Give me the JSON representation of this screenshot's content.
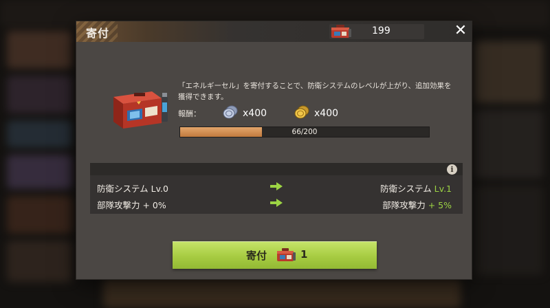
{
  "dialog": {
    "title": "寄付",
    "currency_value": "199",
    "close_label": "✕",
    "description": "「エネルギーセル」を寄付することで、防衛システムのレベルが上がり、追加効果を獲得できます。",
    "reward_label": "報酬：",
    "rewards": [
      {
        "icon": "silver-coin-icon",
        "amount": "x400"
      },
      {
        "icon": "gold-coin-icon",
        "amount": "x400"
      }
    ],
    "progress": {
      "text": "66/200",
      "current": 66,
      "max": 200
    },
    "info_label": "i",
    "stats": [
      {
        "before": "防衛システム Lv.0",
        "after_prefix": "防衛システム ",
        "after_value": "Lv.1"
      },
      {
        "before": "部隊攻撃力 + 0%",
        "after_prefix": "部隊攻撃力 ",
        "after_value": "+ 5%"
      }
    ],
    "donate_button": {
      "label": "寄付",
      "count": "1"
    }
  },
  "colors": {
    "accent_green": "#9dd444",
    "button_green": "#a7cc42",
    "progress_fill": "#d08c50",
    "panel": "#4b4744"
  }
}
